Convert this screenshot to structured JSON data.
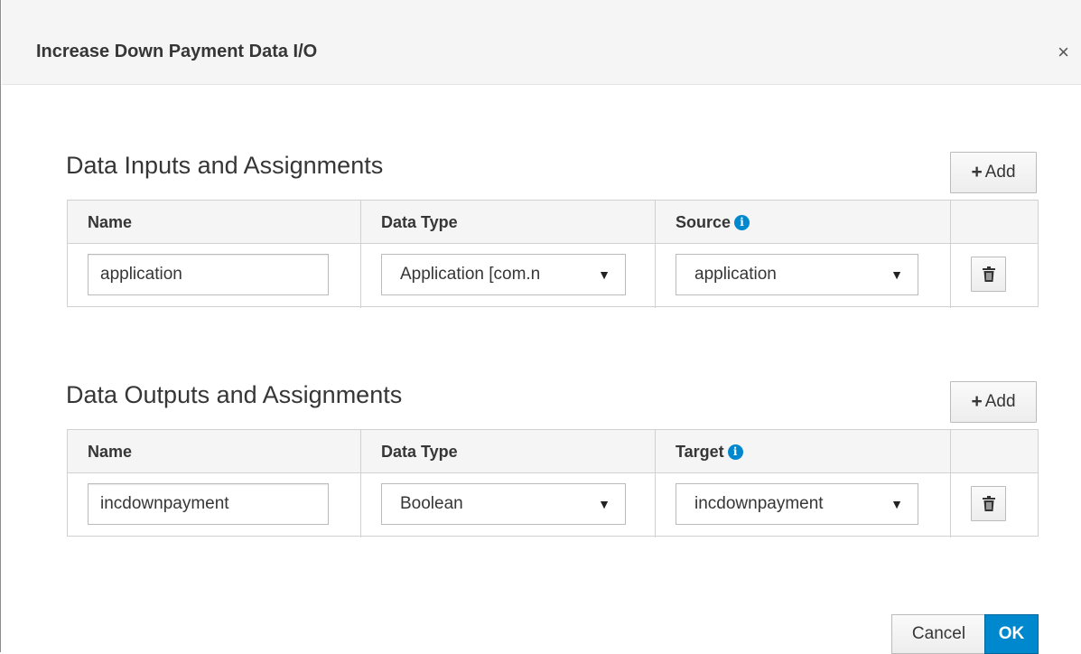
{
  "dialog": {
    "title": "Increase Down Payment Data I/O",
    "close_label": "×"
  },
  "inputs": {
    "section_title": "Data Inputs and Assignments",
    "add_label": "Add",
    "headers": {
      "name": "Name",
      "data_type": "Data Type",
      "source": "Source"
    },
    "rows": [
      {
        "name": "application",
        "data_type": "Application [com.n",
        "source": "application"
      }
    ]
  },
  "outputs": {
    "section_title": "Data Outputs and Assignments",
    "add_label": "Add",
    "headers": {
      "name": "Name",
      "data_type": "Data Type",
      "target": "Target"
    },
    "rows": [
      {
        "name": "incdownpayment",
        "data_type": "Boolean",
        "target": "incdownpayment"
      }
    ]
  },
  "footer": {
    "cancel_label": "Cancel",
    "ok_label": "OK"
  },
  "icons": {
    "info": "info-circle-icon",
    "trash": "trash-icon",
    "plus": "plus-icon",
    "caret": "caret-down-icon"
  },
  "colors": {
    "primary": "#0088ce",
    "header_bg": "#f5f5f5",
    "border": "#d1d1d1"
  }
}
